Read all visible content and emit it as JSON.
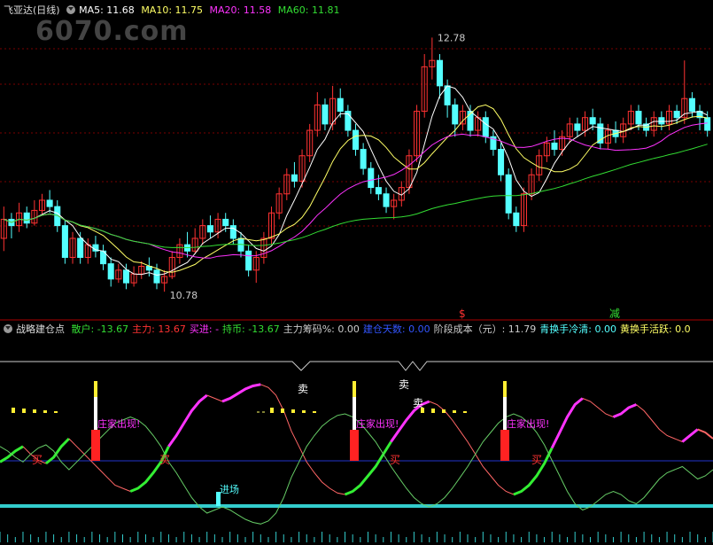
{
  "watermark": "6070.com",
  "main_header": {
    "title": "飞亚达(日线)",
    "ma5": "MA5: 11.68",
    "ma10": "MA10: 11.75",
    "ma20": "MA20: 11.58",
    "ma60": "MA60: 11.81"
  },
  "colors": {
    "up": "#ff3232",
    "down": "#54ffff",
    "ma5": "#ffffff",
    "ma10": "#ffff66",
    "ma20": "#ff33ff",
    "ma60": "#33dd33",
    "grid": "#7a0000"
  },
  "chart_data": [
    {
      "type": "candlestick",
      "high_label": "12.78",
      "low_label": "10.78",
      "signal_labels": [
        {
          "text": "$",
          "color": "#ff3232"
        },
        {
          "text": "减",
          "color": "#33dd33"
        }
      ],
      "candles": [
        [
          11.2,
          11.35,
          11.45,
          11.1
        ],
        [
          11.35,
          11.3,
          11.4,
          11.2
        ],
        [
          11.3,
          11.4,
          11.48,
          11.25
        ],
        [
          11.4,
          11.32,
          11.45,
          11.28
        ],
        [
          11.32,
          11.42,
          11.5,
          11.3
        ],
        [
          11.42,
          11.5,
          11.55,
          11.38
        ],
        [
          11.5,
          11.45,
          11.58,
          11.4
        ],
        [
          11.45,
          11.3,
          11.5,
          11.25
        ],
        [
          11.3,
          11.05,
          11.35,
          11.0
        ],
        [
          11.05,
          11.2,
          11.25,
          11.0
        ],
        [
          11.2,
          11.05,
          11.25,
          11.0
        ],
        [
          11.05,
          11.15,
          11.2,
          11.0
        ],
        [
          11.15,
          11.1,
          11.22,
          11.05
        ],
        [
          11.1,
          11.0,
          11.15,
          10.95
        ],
        [
          11.0,
          10.88,
          11.05,
          10.82
        ],
        [
          10.88,
          10.95,
          11.0,
          10.85
        ],
        [
          10.95,
          10.85,
          11.0,
          10.8
        ],
        [
          10.85,
          10.92,
          10.98,
          10.82
        ],
        [
          10.92,
          10.98,
          11.02,
          10.88
        ],
        [
          10.98,
          10.95,
          11.05,
          10.9
        ],
        [
          10.95,
          10.85,
          11.0,
          10.8
        ],
        [
          10.85,
          10.9,
          10.95,
          10.78
        ],
        [
          10.9,
          11.05,
          11.1,
          10.88
        ],
        [
          11.05,
          11.15,
          11.2,
          11.0
        ],
        [
          11.15,
          11.1,
          11.25,
          11.05
        ],
        [
          11.1,
          11.2,
          11.28,
          11.08
        ],
        [
          11.2,
          11.3,
          11.35,
          11.15
        ],
        [
          11.3,
          11.25,
          11.38,
          11.2
        ],
        [
          11.25,
          11.35,
          11.4,
          11.2
        ],
        [
          11.35,
          11.3,
          11.4,
          11.25
        ],
        [
          11.3,
          11.2,
          11.35,
          11.15
        ],
        [
          11.2,
          11.1,
          11.25,
          11.05
        ],
        [
          11.1,
          10.95,
          11.15,
          10.9
        ],
        [
          10.95,
          11.05,
          11.1,
          10.85
        ],
        [
          11.05,
          11.2,
          11.25,
          11.0
        ],
        [
          11.2,
          11.4,
          11.45,
          11.15
        ],
        [
          11.4,
          11.55,
          11.6,
          11.35
        ],
        [
          11.55,
          11.7,
          11.75,
          11.5
        ],
        [
          11.7,
          11.65,
          11.8,
          11.6
        ],
        [
          11.65,
          11.85,
          11.9,
          11.6
        ],
        [
          11.85,
          12.05,
          12.1,
          11.8
        ],
        [
          12.05,
          12.25,
          12.35,
          12.0
        ],
        [
          12.25,
          12.1,
          12.3,
          12.05
        ],
        [
          12.1,
          12.3,
          12.4,
          12.05
        ],
        [
          12.3,
          12.2,
          12.38,
          12.15
        ],
        [
          12.2,
          12.05,
          12.25,
          12.0
        ],
        [
          12.05,
          11.9,
          12.1,
          11.85
        ],
        [
          11.9,
          11.75,
          11.95,
          11.7
        ],
        [
          11.75,
          11.6,
          11.8,
          11.55
        ],
        [
          11.6,
          11.55,
          11.7,
          11.5
        ],
        [
          11.55,
          11.45,
          11.6,
          11.4
        ],
        [
          11.45,
          11.5,
          11.55,
          11.35
        ],
        [
          11.5,
          11.6,
          11.65,
          11.45
        ],
        [
          11.6,
          11.85,
          11.9,
          11.55
        ],
        [
          11.85,
          12.2,
          12.25,
          11.8
        ],
        [
          12.2,
          12.55,
          12.65,
          12.15
        ],
        [
          12.55,
          12.6,
          12.78,
          12.45
        ],
        [
          12.6,
          12.4,
          12.65,
          12.3
        ],
        [
          12.4,
          12.25,
          12.45,
          12.15
        ],
        [
          12.25,
          12.1,
          12.3,
          12.0
        ],
        [
          12.1,
          12.2,
          12.25,
          12.05
        ],
        [
          12.2,
          12.05,
          12.25,
          12.0
        ],
        [
          12.05,
          12.15,
          12.2,
          12.0
        ],
        [
          12.15,
          12.0,
          12.2,
          11.95
        ],
        [
          12.0,
          11.9,
          12.05,
          11.85
        ],
        [
          11.9,
          11.7,
          11.95,
          11.65
        ],
        [
          11.7,
          11.4,
          11.75,
          11.35
        ],
        [
          11.4,
          11.3,
          11.45,
          11.25
        ],
        [
          11.3,
          11.55,
          11.6,
          11.25
        ],
        [
          11.55,
          11.7,
          11.75,
          11.5
        ],
        [
          11.7,
          11.85,
          11.9,
          11.65
        ],
        [
          11.85,
          11.95,
          12.0,
          11.8
        ],
        [
          11.95,
          11.9,
          12.05,
          11.85
        ],
        [
          11.9,
          12.0,
          12.05,
          11.85
        ],
        [
          12.0,
          12.1,
          12.15,
          11.95
        ],
        [
          12.1,
          12.05,
          12.15,
          12.0
        ],
        [
          12.05,
          12.15,
          12.2,
          12.0
        ],
        [
          12.15,
          12.1,
          12.22,
          12.05
        ],
        [
          12.1,
          11.95,
          12.15,
          11.9
        ],
        [
          11.95,
          12.05,
          12.1,
          11.9
        ],
        [
          12.05,
          12.0,
          12.12,
          11.95
        ],
        [
          12.0,
          12.1,
          12.15,
          11.95
        ],
        [
          12.1,
          12.2,
          12.25,
          12.05
        ],
        [
          12.2,
          12.1,
          12.25,
          12.05
        ],
        [
          12.1,
          12.05,
          12.15,
          12.0
        ],
        [
          12.05,
          12.15,
          12.2,
          12.0
        ],
        [
          12.15,
          12.1,
          12.2,
          12.05
        ],
        [
          12.1,
          12.2,
          12.25,
          12.05
        ],
        [
          12.2,
          12.15,
          12.25,
          12.1
        ],
        [
          12.15,
          12.3,
          12.6,
          12.1
        ],
        [
          12.3,
          12.2,
          12.35,
          12.15
        ],
        [
          12.2,
          12.15,
          12.25,
          12.05
        ],
        [
          12.15,
          12.05,
          12.2,
          12.0
        ]
      ]
    },
    {
      "type": "line",
      "panel_title": "战略建仓点",
      "readouts": [
        {
          "label": "散户",
          "value": "-13.67",
          "color": "#33dd33"
        },
        {
          "label": "主力",
          "value": "13.67",
          "color": "#ff3232"
        },
        {
          "label": "买进",
          "value": "-",
          "color": "#ff33ff"
        },
        {
          "label": "持币",
          "value": "-13.67",
          "color": "#33dd33"
        },
        {
          "label": "主力筹码%",
          "value": "0.00",
          "color": "#cccccc"
        },
        {
          "label": "建仓天数",
          "value": "0.00",
          "color": "#3355ff"
        },
        {
          "label": "阶段成本（元）",
          "value": "11.79",
          "color": "#cccccc"
        },
        {
          "label": "青换手冷清",
          "value": "0.00",
          "color": "#54ffff"
        },
        {
          "label": "黄换手活跃",
          "value": "0.0",
          "color": "#ffff66"
        }
      ],
      "annotations": {
        "sell": "卖",
        "buy": "买",
        "dealer": "庄家出现!",
        "enter": "进场"
      },
      "oscillator": [
        45,
        48,
        52,
        55,
        50,
        46,
        44,
        48,
        55,
        60,
        55,
        50,
        45,
        40,
        35,
        30,
        28,
        26,
        28,
        32,
        38,
        45,
        55,
        62,
        70,
        78,
        84,
        88,
        86,
        84,
        86,
        89,
        92,
        94,
        95,
        93,
        88,
        78,
        65,
        55,
        45,
        38,
        32,
        28,
        25,
        24,
        26,
        30,
        36,
        42,
        50,
        58,
        65,
        72,
        78,
        82,
        84,
        82,
        78,
        72,
        65,
        58,
        50,
        42,
        36,
        30,
        26,
        24,
        26,
        30,
        36,
        44,
        54,
        64,
        74,
        82,
        86,
        84,
        80,
        76,
        74,
        76,
        80,
        82,
        78,
        72,
        66,
        62,
        60,
        58,
        62,
        66,
        64,
        60
      ]
    }
  ]
}
